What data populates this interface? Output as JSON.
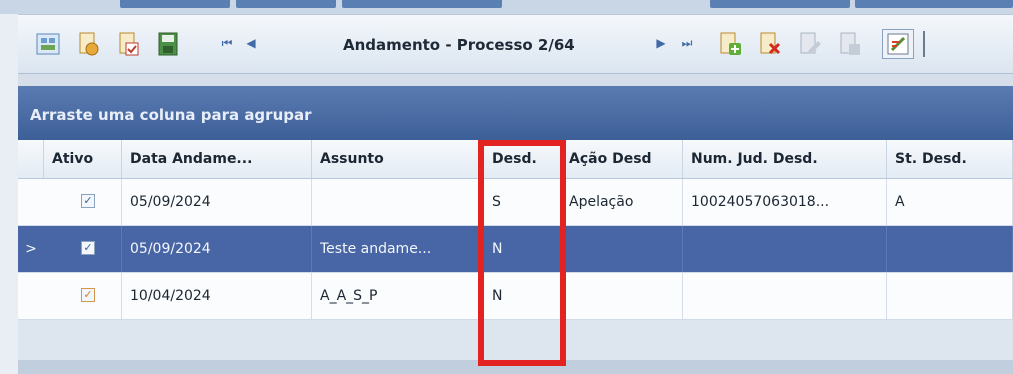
{
  "toolbar": {
    "nav_label": "Andamento - Processo 2/64",
    "buttons": [
      {
        "name": "grid-settings-icon",
        "color": "#6c9ed1"
      },
      {
        "name": "open-document-icon",
        "color": "#e6a93a"
      },
      {
        "name": "check-document-icon",
        "color": "#e6a93a"
      },
      {
        "name": "save-data-icon",
        "color": "#4c8f46"
      },
      {
        "name": "add-record-icon",
        "color": "#e6a93a"
      },
      {
        "name": "delete-record-icon",
        "color": "#e6a93a"
      },
      {
        "name": "edit-record-icon",
        "color": "#a9b4c2"
      },
      {
        "name": "cancel-edit-icon",
        "color": "#a9b4c2"
      },
      {
        "name": "edit-note-icon",
        "color": "#5a8c2f"
      }
    ],
    "nav": {
      "first": "⏮",
      "prev": "◀",
      "next": "▶",
      "last": "⏭"
    }
  },
  "grid": {
    "group_panel_text": "Arraste uma coluna para agrupar",
    "columns": [
      "Ativo",
      "Data Andame...",
      "Assunto",
      "Desd.",
      "Ação Desd",
      "Num. Jud. Desd.",
      "St. Desd."
    ],
    "rows": [
      {
        "ativo": "✓",
        "ativo_color": "blue",
        "data": "05/09/2024",
        "assunto": "",
        "desd": "S",
        "acao": "Apelação",
        "num": "10024057063018...",
        "st": "A",
        "selected": false
      },
      {
        "ativo": "✓",
        "ativo_color": "blue",
        "data": "05/09/2024",
        "assunto": "Teste andame...",
        "desd": "N",
        "acao": "",
        "num": "",
        "st": "",
        "selected": true
      },
      {
        "ativo": "✓",
        "ativo_color": "orange",
        "data": "10/04/2024",
        "assunto": "A_A_S_P",
        "desd": "N",
        "acao": "",
        "num": "",
        "st": "",
        "selected": false
      }
    ],
    "row_indicator": ">"
  },
  "colors": {
    "accent": "#4866a6",
    "highlight": "#e32222"
  }
}
